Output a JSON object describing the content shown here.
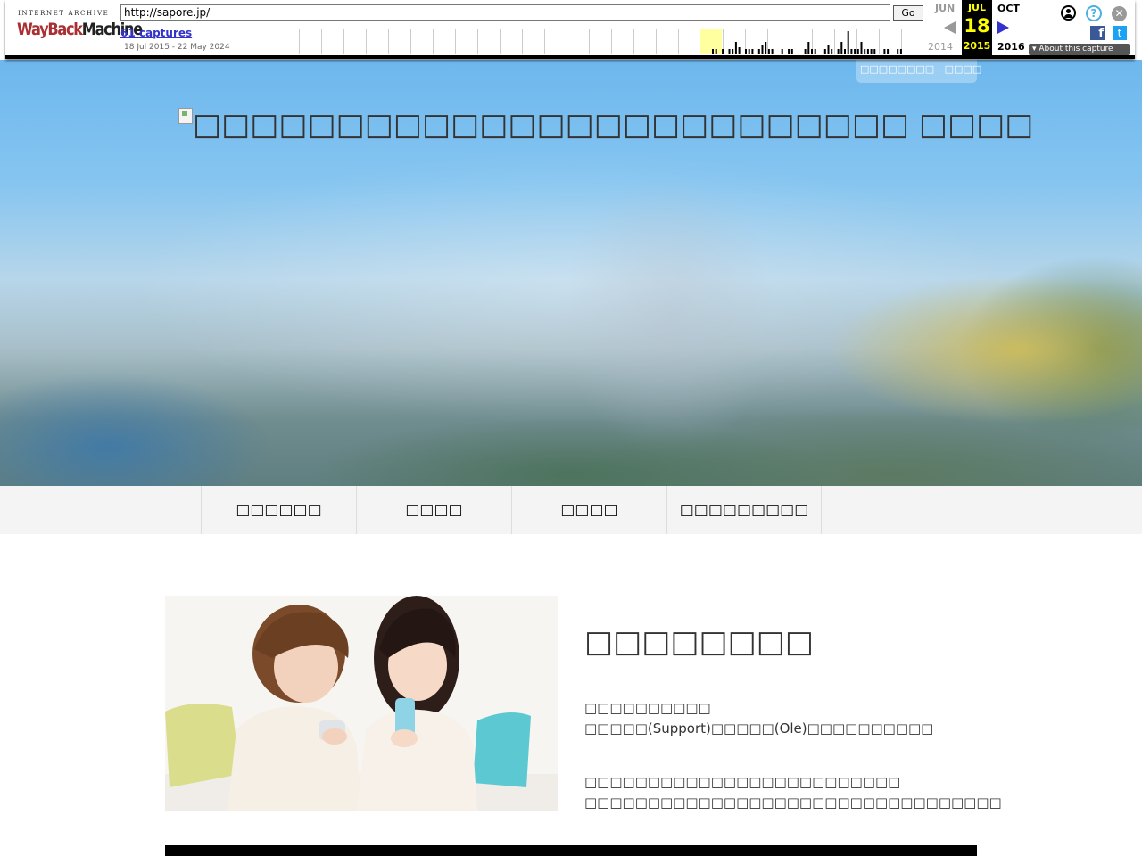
{
  "wayback": {
    "logo_small": "INTERNET ARCHIVE",
    "logo_wayback": "WayBack",
    "logo_machine": "Machine",
    "url": "http://sapore.jp/",
    "go_label": "Go",
    "captures_label": "61 captures",
    "date_range": "18 Jul 2015 - 22 May 2024",
    "prev_month": "JUN",
    "cur_month": "JUL",
    "next_month": "OCT",
    "cur_day": "18",
    "prev_year": "2014",
    "cur_year": "2015",
    "next_year": "2016",
    "about_label": "About this capture",
    "help_glyph": "?",
    "close_glyph": "✕",
    "fb_glyph": "f",
    "tw_glyph": "t"
  },
  "header": {
    "util_links": [
      "□□□□□□□□",
      "□□□□"
    ],
    "logo_alt": "□□□□□□□□□□□□□□□□□□□□□□□□□ □□□□"
  },
  "nav": {
    "items": [
      "□□□□□□",
      "□□□□",
      "□□□□",
      "□□□□□□□□□"
    ]
  },
  "main": {
    "heading": "□□□□□□□□",
    "para1_line1": "□□□□□□□□□□",
    "para1_line2": "□□□□□(Support)□□□□□(Ole)□□□□□□□□□□",
    "para2_line1": "□□□□□□□□□□□□□□□□□□□□□□□□□",
    "para2_line2": "□□□□□□□□□□□□□□□□□□□□□□□□□□□□□□□□□"
  },
  "colors": {
    "wayback_red": "#ab2e33",
    "link_blue": "#3333cc",
    "highlight_yellow": "#ffff00",
    "nav_bg": "#f4f4f4"
  }
}
